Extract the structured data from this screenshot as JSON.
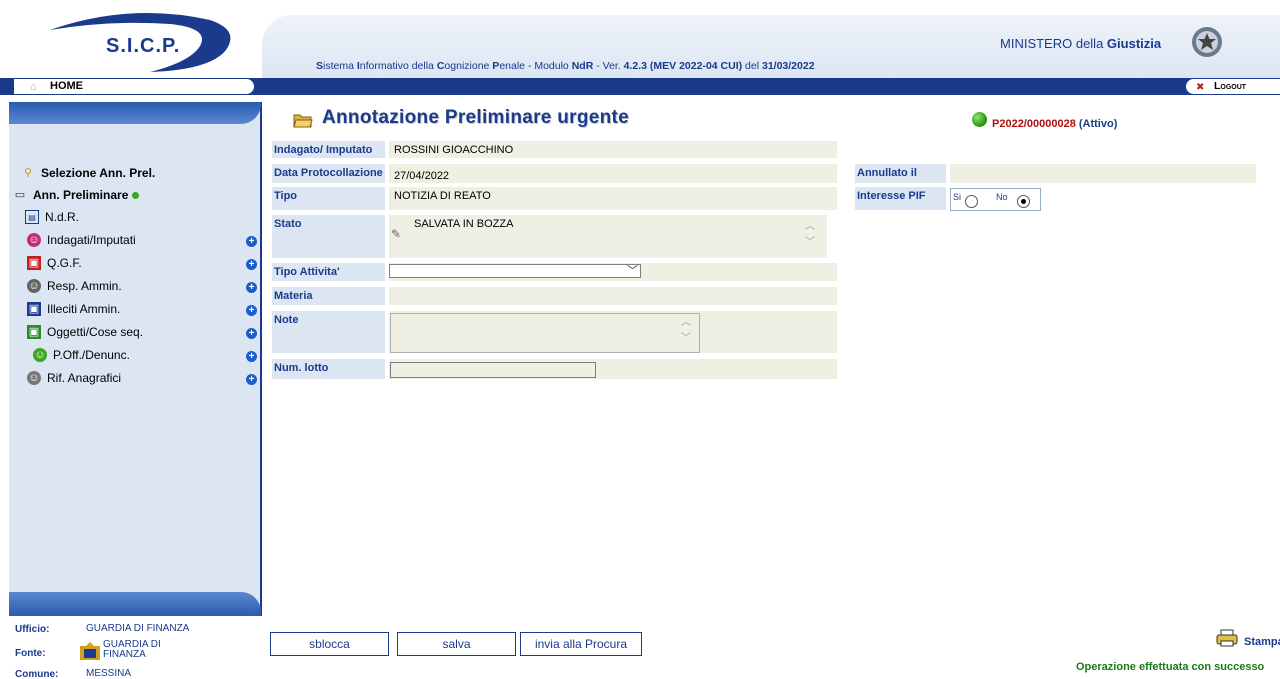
{
  "header": {
    "logo_text": "S.I.C.P.",
    "subtitle_parts": [
      "S",
      "istema ",
      "I",
      "nformativo della ",
      "C",
      "ognizione ",
      "P",
      "enale - Modulo ",
      "NdR",
      " - Ver. ",
      "4.2.3 (MEV 2022-04 CUI)",
      " del ",
      "31/03/2022"
    ],
    "ministry_prefix": "MINISTERO della ",
    "ministry_bold": "Giustizia"
  },
  "menubar": {
    "home_label": "HOME",
    "logout_label": "Logout"
  },
  "sidebar": {
    "items": [
      {
        "label": "Selezione Ann. Prel.",
        "icon": "magnifier-icon"
      },
      {
        "label": "Ann. Preliminare",
        "icon": "folder-icon"
      },
      {
        "label": "N.d.R.",
        "icon": "document-icon"
      },
      {
        "label": "Indagati/Imputati",
        "icon": "person-red-icon"
      },
      {
        "label": "Q.G.F.",
        "icon": "qgf-icon"
      },
      {
        "label": "Resp. Ammin.",
        "icon": "person-grey-icon"
      },
      {
        "label": "Illeciti Ammin.",
        "icon": "illeciti-icon"
      },
      {
        "label": "Oggetti/Cose seq.",
        "icon": "box-green-icon"
      },
      {
        "label": "P.Off./Denunc.",
        "icon": "person-green-icon"
      },
      {
        "label": "Rif. Anagrafici",
        "icon": "person-grey-icon"
      }
    ],
    "plus": "+"
  },
  "footer_info": {
    "ufficio_label": "Ufficio:",
    "ufficio_value": "GUARDIA DI FINANZA",
    "fonte_label": "Fonte:",
    "fonte_value_1": "GUARDIA DI",
    "fonte_value_2": "FINANZA",
    "comune_label": "Comune:",
    "comune_value": "MESSINA"
  },
  "main": {
    "title": "Annotazione Preliminare urgente",
    "protocol": "P2022/00000028",
    "protocol_status": "(Attivo)",
    "fields": {
      "indagato_label": "Indagato/ Imputato",
      "indagato_value": "ROSSINI GIOACCHINO",
      "data_label": "Data Protocollazione",
      "data_value": "27/04/2022",
      "tipo_label": "Tipo",
      "tipo_value": "NOTIZIA DI REATO",
      "stato_label": "Stato",
      "stato_value": "SALVATA IN BOZZA",
      "tipo_attivita_label": "Tipo Attivita'",
      "tipo_attivita_value": "",
      "materia_label": "Materia",
      "note_label": "Note",
      "num_lotto_label": "Num. lotto",
      "annullato_label": "Annullato il",
      "interesse_label": "Interesse PIF",
      "si_label": "Si",
      "no_label": "No"
    }
  },
  "actions": {
    "sblocca": "sblocca",
    "salva": "salva",
    "invia": "invia alla Procura",
    "stampa": "Stampa",
    "message": "Operazione effettuata con successo"
  },
  "colors": {
    "brand": "#1a3a8c",
    "label_bg": "#dce6f3",
    "value_bg": "#f0efe4",
    "success": "#1a7a1a",
    "protocol": "#b01010"
  }
}
